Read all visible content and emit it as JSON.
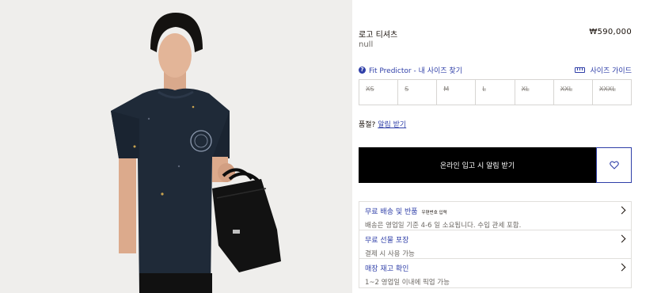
{
  "product": {
    "name": "로고 티셔츠",
    "price": "₩590,000",
    "subtitle": "null",
    "image_alt": "model wearing distressed navy logo t-shirt with black bag"
  },
  "fit": {
    "predictor_label": "Fit Predictor - 내 사이즈 찾기",
    "size_guide_label": "사이즈 가이드"
  },
  "sizes": [
    "XS",
    "S",
    "M",
    "L",
    "XL",
    "XXL",
    "XXXL"
  ],
  "stock": {
    "question": "품절?",
    "notify_link": "알림 받기"
  },
  "cta": {
    "notify_label": "온라인 입고 시 알림 받기"
  },
  "services": [
    {
      "title": "무료 배송 및 반품",
      "tag": "우편번호 입력",
      "desc": "배송은 영업일 기준 4-6 일 소요됩니다. 수입 관세 포함."
    },
    {
      "title": "무료 선물 포장",
      "tag": "",
      "desc": "결제 시 사용 가능"
    },
    {
      "title": "매장 재고 확인",
      "tag": "",
      "desc": "1~2 영업일 이내에 픽업 가능"
    }
  ],
  "colors": {
    "accent": "#2f3fa8",
    "cta_bg": "#000000",
    "photo_bg": "#efeeec",
    "shirt": "#1f2a38"
  },
  "icons": {
    "fit": "fit-predictor-icon",
    "guide": "ruler-icon",
    "wish": "heart-icon",
    "chevron": "chevron-right-icon"
  }
}
